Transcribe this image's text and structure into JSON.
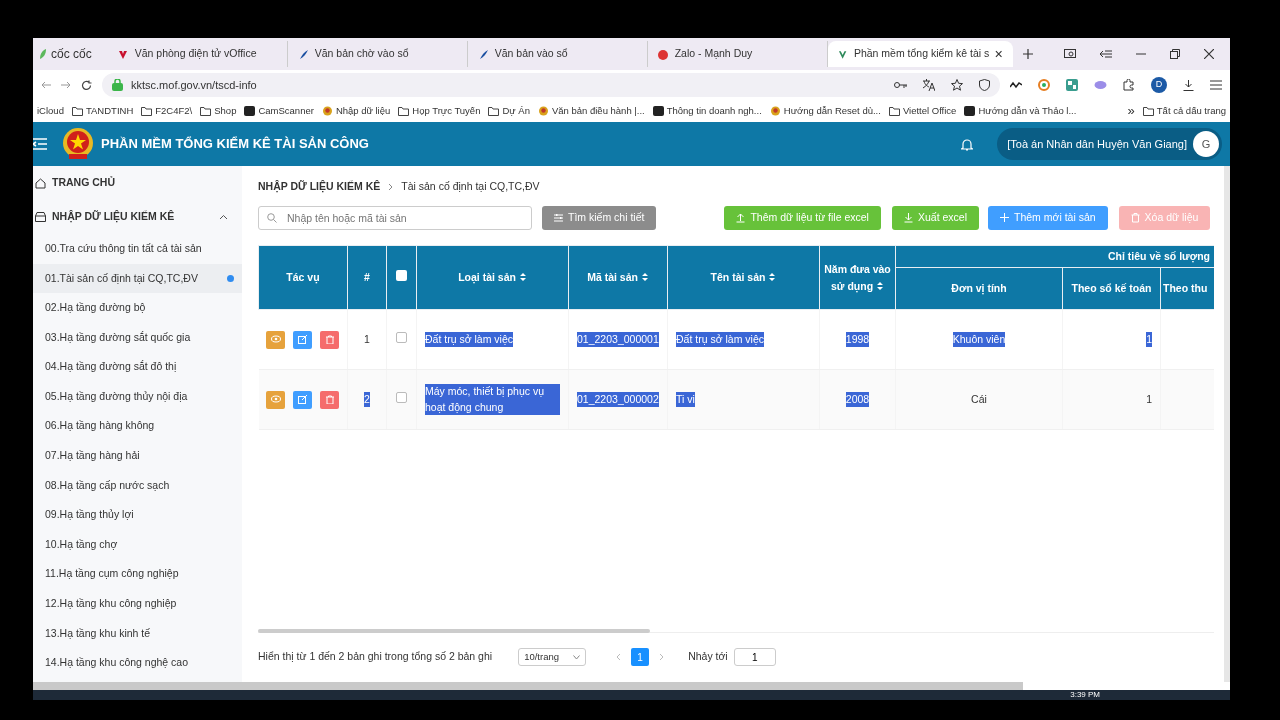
{
  "browser": {
    "brand": "cốc cốc",
    "tabs": [
      {
        "title": "Văn phòng điện tử vOffice",
        "selected": false
      },
      {
        "title": "Văn bản chờ vào sổ",
        "selected": false
      },
      {
        "title": "Văn bản vào sổ",
        "selected": false
      },
      {
        "title": "Zalo - Mạnh Duy",
        "selected": false
      },
      {
        "title": "Phần mềm tổng kiểm kê tài s",
        "selected": true
      }
    ],
    "url": "kktsc.mof.gov.vn/tscd-info",
    "profile": "D",
    "bookmarks": [
      {
        "label": "iCloud",
        "kind": "plain"
      },
      {
        "label": "TANDTINH",
        "kind": "folder"
      },
      {
        "label": "F2C4F2\\",
        "kind": "folder"
      },
      {
        "label": "Shop",
        "kind": "folder"
      },
      {
        "label": "CamScanner",
        "kind": "site"
      },
      {
        "label": "Nhập dữ liệu",
        "kind": "emblem"
      },
      {
        "label": "Họp Trực Tuyến",
        "kind": "folder"
      },
      {
        "label": "Dự Án",
        "kind": "folder"
      },
      {
        "label": "Văn bản điều hành |...",
        "kind": "emblem"
      },
      {
        "label": "Thông tin doanh ngh...",
        "kind": "site"
      },
      {
        "label": "Hướng dẫn Reset dù...",
        "kind": "emblem"
      },
      {
        "label": "Viettel Office",
        "kind": "folder"
      },
      {
        "label": "Hướng dẫn và Thảo l...",
        "kind": "site"
      }
    ],
    "more": "»",
    "all_bookmarks": "Tất cả dấu trang"
  },
  "header": {
    "title": "PHẦN MỀM TỔNG KIỂM KÊ TÀI SẢN CÔNG",
    "org": "[Toà án Nhân dân Huyện Văn Giang]",
    "avatar": "G"
  },
  "sidebar": {
    "home": "TRANG CHỦ",
    "section": {
      "label": "NHẬP DỮ LIỆU KIỂM KÊ",
      "expanded": true
    },
    "items": [
      {
        "label": "00.Tra cứu thông tin tất cả tài sản",
        "selected": false
      },
      {
        "label": "01.Tài sản cố định tại CQ,TC,ĐV",
        "selected": true
      },
      {
        "label": "02.Hạ tầng đường bộ",
        "selected": false
      },
      {
        "label": "03.Hạ tầng đường sắt quốc gia",
        "selected": false
      },
      {
        "label": "04.Hạ tầng đường sắt đô thị",
        "selected": false
      },
      {
        "label": "05.Hạ tầng đường thủy nội địa",
        "selected": false
      },
      {
        "label": "06.Hạ tầng hàng không",
        "selected": false
      },
      {
        "label": "07.Hạ tầng hàng hải",
        "selected": false
      },
      {
        "label": "08.Hạ tầng cấp nước sạch",
        "selected": false
      },
      {
        "label": "09.Hạ tầng thủy lợi",
        "selected": false
      },
      {
        "label": "10.Hạ tầng chợ",
        "selected": false
      },
      {
        "label": "11.Hạ tầng cụm công nghiệp",
        "selected": false
      },
      {
        "label": "12.Hạ tầng khu công nghiệp",
        "selected": false
      },
      {
        "label": "13.Hạ tầng khu kinh tế",
        "selected": false
      },
      {
        "label": "14.Hạ tầng khu công nghệ cao",
        "selected": false
      }
    ]
  },
  "breadcrumb": [
    "NHẬP DỮ LIỆU KIỂM KÊ",
    "Tài sản cố định tại CQ,TC,ĐV"
  ],
  "search": {
    "placeholder": "Nhập tên hoặc mã tài sản"
  },
  "buttons": [
    {
      "label": "Tìm kiếm chi tiết",
      "kind": "filter",
      "disabled": false
    },
    {
      "label": "Thêm dữ liệu từ file excel",
      "kind": "upload",
      "disabled": false
    },
    {
      "label": "Xuất excel",
      "kind": "download",
      "disabled": false
    },
    {
      "label": "Thêm mới tài sản",
      "kind": "add",
      "disabled": false
    },
    {
      "label": "Xóa dữ liệu",
      "kind": "delete",
      "disabled": true
    }
  ],
  "table": {
    "columns": [
      {
        "label": "Tác vụ",
        "sortable": false
      },
      {
        "label": "#",
        "sortable": false
      },
      {
        "kind": "checkbox",
        "checked": false
      },
      {
        "label": "Loại tài sản",
        "sortable": true
      },
      {
        "label": "Mã tài sản",
        "sortable": true
      },
      {
        "label": "Tên tài sản",
        "sortable": true
      },
      {
        "label": "Năm đưa vào sử dụng",
        "sortable": true
      }
    ],
    "group": {
      "label": "Chỉ tiêu về số lượng",
      "columns": [
        "Đơn vị tính",
        "Theo sổ kế toán",
        "Theo thu"
      ]
    },
    "rows": [
      {
        "cells": [
          {
            "kind": "actions"
          },
          {
            "text": "1",
            "highlighted": false
          },
          {
            "kind": "checkbox",
            "checked": false
          },
          {
            "text": "Đất trụ sở làm việc",
            "highlighted": true
          },
          {
            "text": "01_2203_000001",
            "highlighted": true
          },
          {
            "text": "Đất trụ sở làm việc",
            "highlighted": true
          },
          {
            "text": "1998",
            "highlighted": true
          },
          {
            "text": "Khuôn viên",
            "highlighted": true
          },
          {
            "text": "1",
            "highlighted": true
          }
        ]
      },
      {
        "cells": [
          {
            "kind": "actions"
          },
          {
            "text": "2",
            "highlighted": true
          },
          {
            "kind": "checkbox",
            "checked": false
          },
          {
            "text": "Máy móc, thiết bị phục vụ hoạt động chung",
            "highlighted": true
          },
          {
            "text": "01_2203_000002",
            "highlighted": true
          },
          {
            "text": "Ti vi",
            "highlighted": true
          },
          {
            "text": "2008",
            "highlighted": true
          },
          {
            "text": "Cái",
            "highlighted": false
          },
          {
            "text": "1",
            "highlighted": false
          }
        ]
      }
    ]
  },
  "pagination": {
    "summary": "Hiển thị từ 1 đến 2 bản ghi trong tổng số 2 bản ghi",
    "page_size": "10/trang",
    "pages": [
      {
        "label": "1",
        "selected": true
      }
    ],
    "jump_label": "Nhảy tới",
    "jump_value": "1"
  },
  "taskbar": {
    "time": "3:39 PM"
  }
}
